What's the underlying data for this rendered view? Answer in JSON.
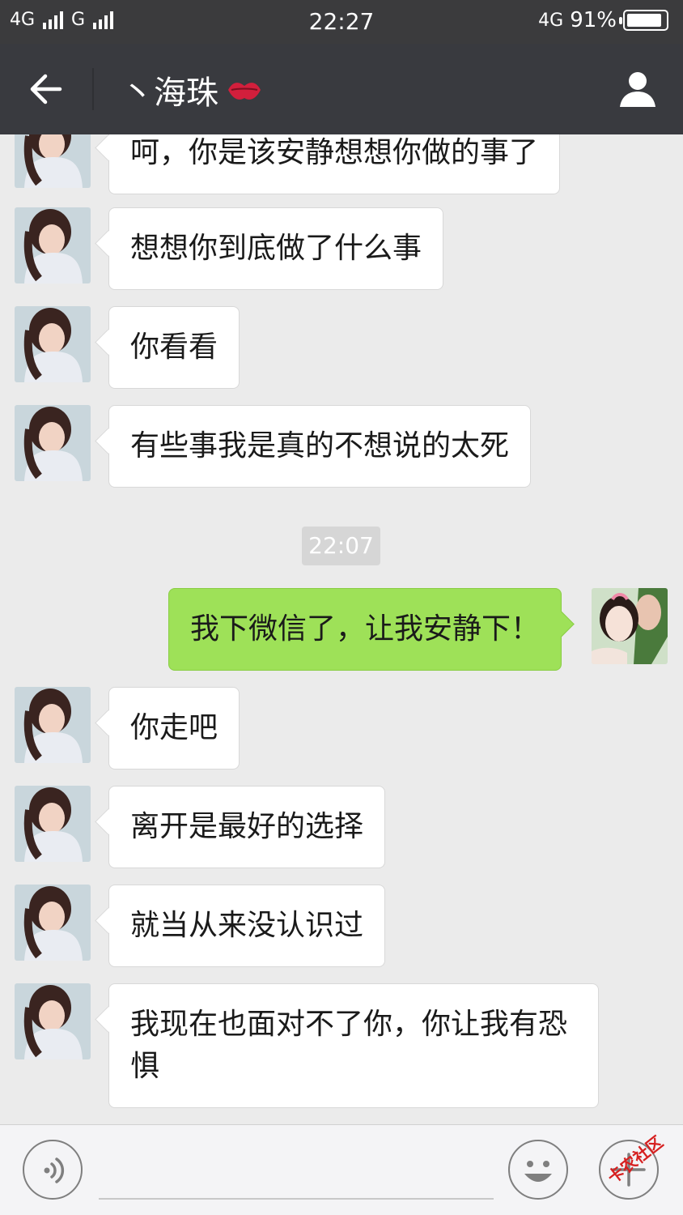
{
  "status_bar": {
    "network1": "4G",
    "network2": "G",
    "time": "22:27",
    "network3": "4G",
    "battery_text": "91%",
    "battery_level": 0.91
  },
  "header": {
    "title": "丶海珠"
  },
  "messages": [
    {
      "side": "in",
      "text": "呵，你是该安静想想你做的事了"
    },
    {
      "side": "in",
      "text": "想想你到底做了什么事"
    },
    {
      "side": "in",
      "text": "你看看"
    },
    {
      "side": "in",
      "text": "有些事我是真的不想说的太死"
    },
    {
      "side": "time",
      "text": "22:07"
    },
    {
      "side": "out",
      "text": "我下微信了，让我安静下！"
    },
    {
      "side": "in",
      "text": "你走吧"
    },
    {
      "side": "in",
      "text": "离开是最好的选择"
    },
    {
      "side": "in",
      "text": "就当从来没认识过"
    },
    {
      "side": "in",
      "line1": "我现在也面对不了你，你让我有恐",
      "line2": "惧"
    }
  ],
  "watermark": "卡农社区",
  "colors": {
    "header_bg": "#393a3f",
    "chat_bg": "#ebebeb",
    "out_bubble": "#9ee158",
    "in_bubble": "#ffffff"
  }
}
